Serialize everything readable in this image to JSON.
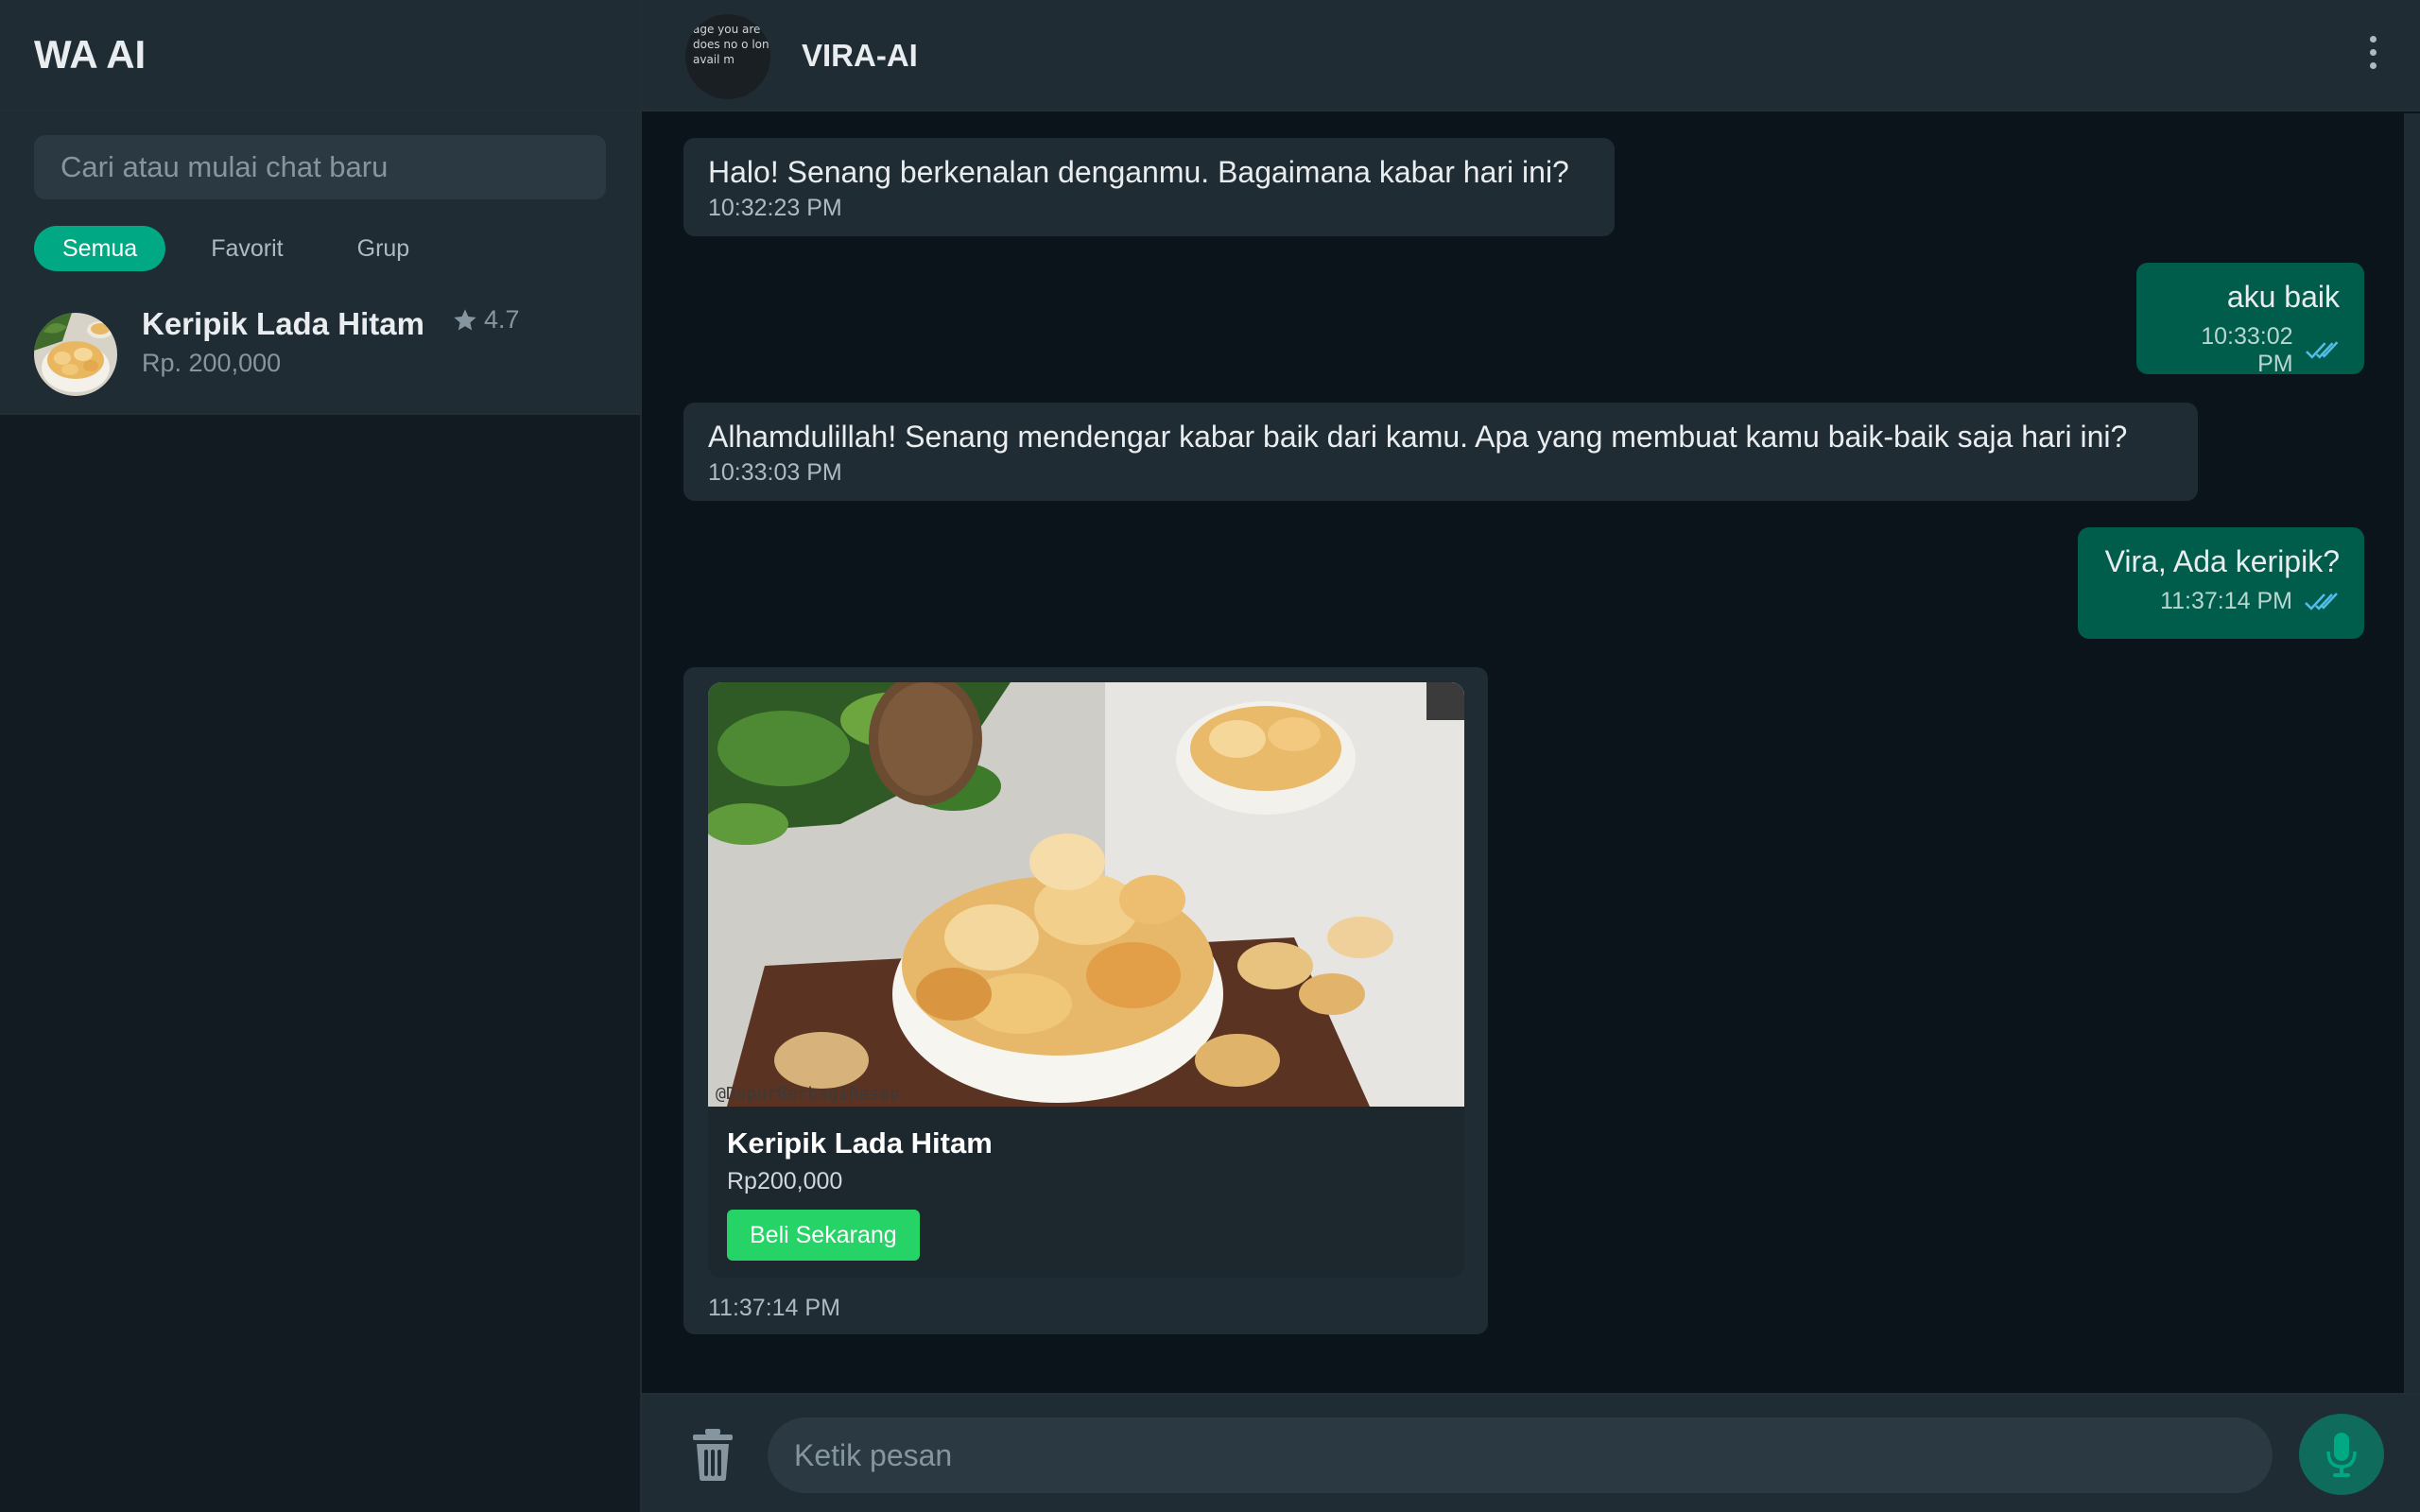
{
  "app": {
    "title": "WA AI"
  },
  "sidebar": {
    "search_placeholder": "Cari atau mulai chat baru",
    "filters": [
      "Semua",
      "Favorit",
      "Grup"
    ],
    "active_filter": "Semua",
    "chats": [
      {
        "name": "Keripik Lada Hitam",
        "subtitle": "Rp. 200,000",
        "rating": "4.7",
        "icon": "star-icon"
      }
    ]
  },
  "chat": {
    "contact_name": "VIRA-AI",
    "avatar_alt_text": "age you are sting does no o longer avail m",
    "messages": [
      {
        "direction": "in",
        "text": "Halo! Senang berkenalan denganmu. Bagaimana kabar hari ini?",
        "time": "10:32:23 PM"
      },
      {
        "direction": "out",
        "text": "aku baik",
        "time": "10:33:02 PM",
        "status": "read"
      },
      {
        "direction": "in",
        "text": "Alhamdulillah! Senang mendengar kabar baik dari kamu. Apa yang membuat kamu baik-baik saja hari ini?",
        "time": "10:33:03 PM"
      },
      {
        "direction": "out",
        "text": "Vira, Ada keripik?",
        "time": "11:37:14 PM",
        "status": "read"
      }
    ],
    "product_message": {
      "name": "Keripik Lada Hitam",
      "price": "Rp200,000",
      "button_label": "Beli Sekarang",
      "image_watermark": "@DapurBerbagiResep",
      "time": "11:37:14 PM"
    }
  },
  "composer": {
    "placeholder": "Ketik pesan",
    "left_icon": "trash-icon",
    "right_icon": "microphone-icon"
  },
  "colors": {
    "accent": "#00a884",
    "outgoing_bubble": "#005c4b",
    "incoming_bubble": "#202c33",
    "buy_button": "#25d366",
    "read_ticks": "#53bdeb"
  }
}
